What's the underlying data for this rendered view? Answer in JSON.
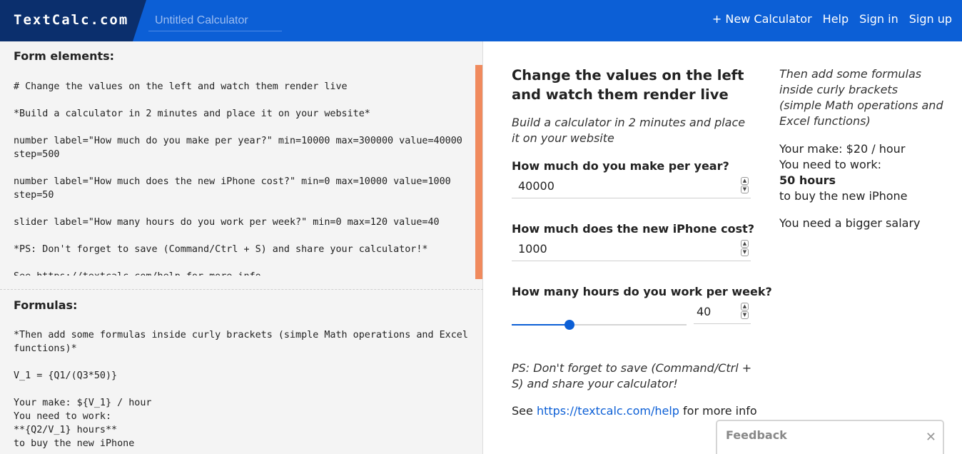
{
  "header": {
    "logo": "TextCalc.com",
    "title_placeholder": "Untitled Calculator",
    "nav": [
      "+ New Calculator",
      "Help",
      "Sign in",
      "Sign up"
    ]
  },
  "editor": {
    "form_title": "Form elements:",
    "form_code": "# Change the values on the left and watch them render live\n\n*Build a calculator in 2 minutes and place it on your website*\n\nnumber label=\"How much do you make per year?\" min=10000 max=300000 value=40000 step=500\n\nnumber label=\"How much does the new iPhone cost?\" min=0 max=10000 value=1000 step=50\n\nslider label=\"How many hours do you work per week?\" min=0 max=120 value=40\n\n*PS: Don't forget to save (Command/Ctrl + S) and share your calculator!*\n\nSee https://textcalc.com/help for more info",
    "formulas_title": "Formulas:",
    "formulas_code": "*Then add some formulas inside curly brackets (simple Math operations and Excel functions)*\n\nV_1 = {Q1/(Q3*50)}\n\nYour make: ${V_1} / hour\nYou need to work:\n**{Q2/V_1} hours**\nto buy the new iPhone"
  },
  "preview": {
    "title": "Change the values on the left and watch them render live",
    "subtitle": "Build a calculator in 2 minutes and place it on your website",
    "q1": {
      "label": "How much do you make per year?",
      "value": "40000"
    },
    "q2": {
      "label": "How much does the new iPhone cost?",
      "value": "1000"
    },
    "q3": {
      "label": "How many hours do you work per week?",
      "value": "40",
      "min": 0,
      "max": 120,
      "fraction": 0.33
    },
    "ps": "PS: Don't forget to save (Command/Ctrl + S) and share your calculator!",
    "see_prefix": "See ",
    "see_link": "https://textcalc.com/help",
    "see_suffix": " for more info",
    "formulas_note": "Then add some formulas inside curly brackets (simple Math operations and Excel functions)",
    "result_make": "Your make: $20 / hour",
    "result_need": "You need to work:",
    "result_hours": "50 hours",
    "result_buy": "to buy the new iPhone",
    "result_salary": "You need a bigger salary"
  },
  "feedback": {
    "label": "Feedback",
    "close": "✕"
  },
  "colors": {
    "header": "#0c5fd6",
    "logo_bg": "#0b2f6d",
    "accent": "#0c5fd6",
    "scrollbar": "#f08a5d"
  }
}
